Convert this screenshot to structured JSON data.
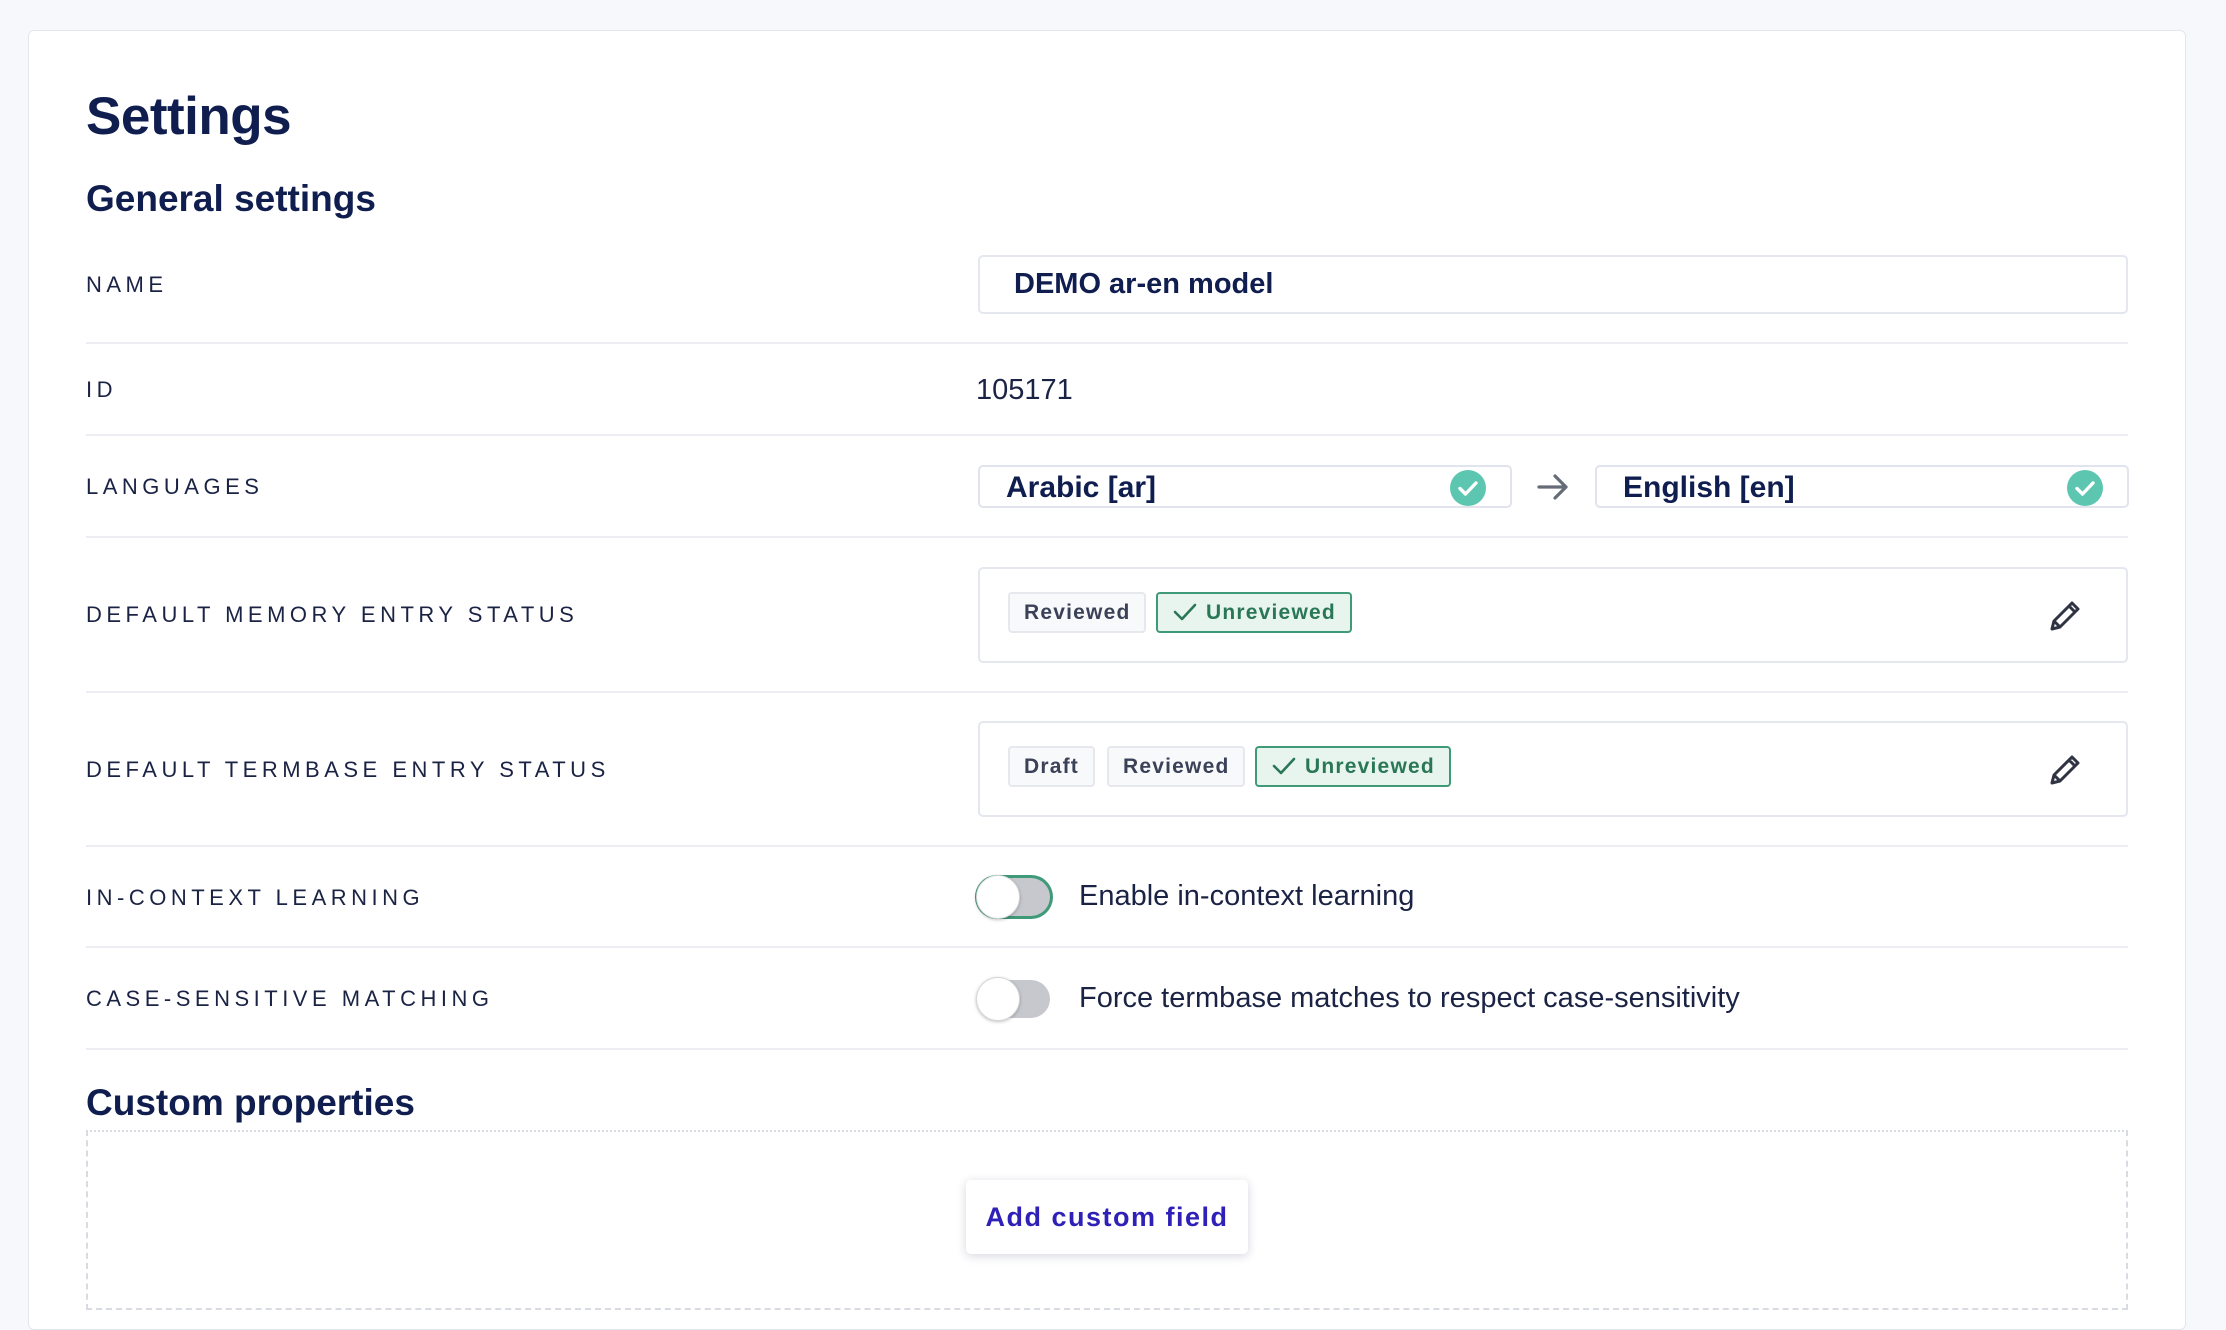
{
  "page": {
    "title": "Settings"
  },
  "general": {
    "title": "General settings",
    "name": {
      "label": "NAME",
      "value": "DEMO ar-en model"
    },
    "id": {
      "label": "ID",
      "value": "105171"
    },
    "languages": {
      "label": "LANGUAGES",
      "source": "Arabic [ar]",
      "target": "English [en]",
      "check_color": "#5cc6b0"
    },
    "memory_status": {
      "label": "DEFAULT MEMORY ENTRY STATUS",
      "tags": [
        "Reviewed",
        "Unreviewed"
      ],
      "selected": "Unreviewed"
    },
    "termbase_status": {
      "label": "DEFAULT TERMBASE ENTRY STATUS",
      "tags": [
        "Draft",
        "Reviewed",
        "Unreviewed"
      ],
      "selected": "Unreviewed"
    },
    "in_context": {
      "label": "IN-CONTEXT LEARNING",
      "toggle_label": "Enable in-context learning",
      "enabled": false
    },
    "case_sensitive": {
      "label": "CASE-SENSITIVE MATCHING",
      "toggle_label": "Force termbase matches to respect case-sensitivity",
      "enabled": false
    }
  },
  "custom": {
    "title": "Custom properties",
    "add_button": "Add custom field"
  },
  "colors": {
    "heading": "#101d4f",
    "selected_tag": "#3f9a78",
    "button_text": "#2f21b8"
  }
}
